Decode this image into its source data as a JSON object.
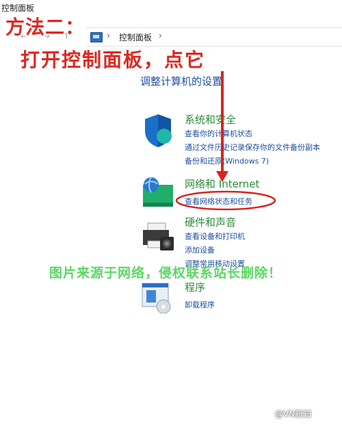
{
  "window": {
    "title": "控制面板"
  },
  "nav": {
    "back": "←",
    "forward": "→",
    "up": "↑"
  },
  "address": {
    "separator": "›",
    "path": "控制面板",
    "end_separator": "›"
  },
  "overlay": {
    "line1": "方法二：",
    "line2": "打开控制面板，点它"
  },
  "main": {
    "heading": "调整计算机的设置"
  },
  "categories": [
    {
      "title": "系统和安全",
      "icon": "shield-icon",
      "links": [
        "查看你的计算机状态",
        "通过文件历史记录保存你的文件备份副本",
        "备份和还原(Windows 7)"
      ]
    },
    {
      "title": "网络和 Internet",
      "icon": "network-icon",
      "links": [
        "查看网络状态和任务"
      ]
    },
    {
      "title": "硬件和声音",
      "icon": "printer-icon",
      "links": [
        "查看设备和打印机",
        "添加设备",
        "调整常用移动设置"
      ]
    },
    {
      "title": "程序",
      "icon": "programs-icon",
      "links": [
        "卸载程序"
      ]
    }
  ],
  "watermark": "图片来源于网络，侵权联系站长删除！",
  "credit": "@VN新知",
  "colors": {
    "accent_red": "#e0261f",
    "link_blue": "#1f4fa0",
    "category_green": "#2e8b3c",
    "watermark_green": "#3fd14a"
  }
}
